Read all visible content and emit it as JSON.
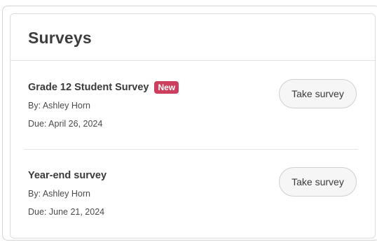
{
  "panel": {
    "title": "Surveys"
  },
  "surveys": [
    {
      "title": "Grade 12 Student Survey",
      "badge": "New",
      "author": "By: Ashley Horn",
      "due": "Due: April 26, 2024",
      "action_label": "Take survey"
    },
    {
      "title": "Year-end survey",
      "badge": "",
      "author": "By: Ashley Horn",
      "due": "Due: June 21, 2024",
      "action_label": "Take survey"
    }
  ],
  "colors": {
    "badge_background": "#cc3e5d",
    "button_background": "#f6f6f6",
    "border": "#dcdcdc"
  }
}
